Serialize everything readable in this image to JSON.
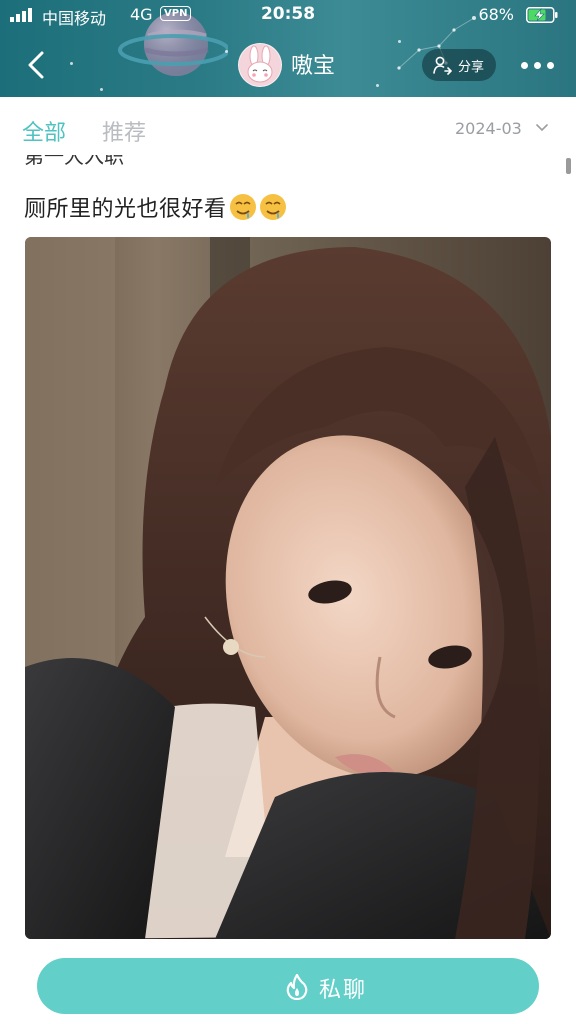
{
  "status_bar": {
    "carrier": "中国移动",
    "network": "4G",
    "vpn": "VPN",
    "time": "20:58",
    "battery": "68%"
  },
  "header": {
    "back_icon": "chevron-left-icon",
    "nickname": "嗷宝",
    "share_label": "分享",
    "share_icon": "user-share-icon",
    "more_icon": "more-dots-icon"
  },
  "tabs": [
    {
      "label": "全部",
      "active": true
    },
    {
      "label": "推荐",
      "active": false
    }
  ],
  "date_filter": "2024-03",
  "feed": {
    "previous_post_text": "第一大入职",
    "post_text": "厕所里的光也很好看",
    "emojis": [
      "drooling-face-icon",
      "drooling-face-icon"
    ]
  },
  "bottom": {
    "chat_label": "私聊",
    "chat_icon": "flame-icon"
  },
  "colors": {
    "header_bg": "#2b7b86",
    "accent": "#4fc3c0",
    "chat_button": "#62cfc9",
    "inactive_tab": "#b9bcc0"
  }
}
